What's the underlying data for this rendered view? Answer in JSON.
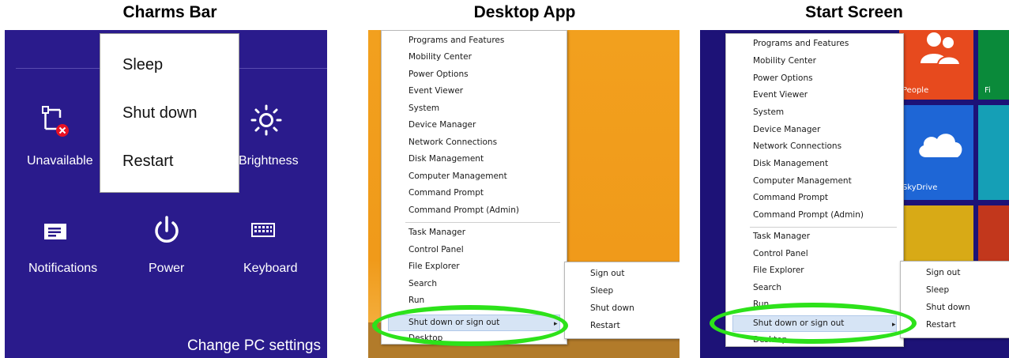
{
  "titles": {
    "charms": "Charms Bar",
    "desktop": "Desktop App",
    "start": "Start Screen"
  },
  "charms": {
    "power_menu": [
      "Sleep",
      "Shut down",
      "Restart"
    ],
    "unavailable_label": "Unavailable",
    "brightness_label": "Brightness",
    "notifications_label": "Notifications",
    "power_label": "Power",
    "keyboard_label": "Keyboard",
    "change_pc_settings": "Change PC settings"
  },
  "winx_menu": {
    "group1": [
      "Programs and Features",
      "Mobility Center",
      "Power Options",
      "Event Viewer",
      "System",
      "Device Manager",
      "Network Connections",
      "Disk Management",
      "Computer Management",
      "Command Prompt",
      "Command Prompt (Admin)"
    ],
    "group2": [
      "Task Manager",
      "Control Panel",
      "File Explorer",
      "Search",
      "Run",
      "Shut down or sign out",
      "Desktop"
    ],
    "submenu": [
      "Sign out",
      "Sleep",
      "Shut down",
      "Restart"
    ]
  },
  "start_tiles": {
    "people_label": "People",
    "skydrive_label": "SkyDrive",
    "partial_label": "Fi"
  },
  "colors": {
    "charms_bg": "#2a1b8c",
    "desktop_bg": "#f2a01e",
    "start_bg": "#1d1277",
    "highlight": "#2de21a",
    "people_tile": "#e74a1e",
    "skydrive_tile": "#1e66d6"
  }
}
